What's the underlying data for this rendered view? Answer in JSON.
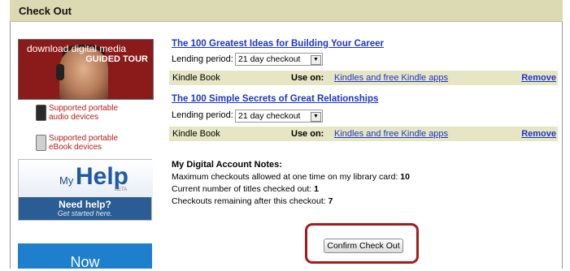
{
  "header": {
    "title": "Check Out"
  },
  "sidebar": {
    "banner": {
      "line1": "download digital media",
      "line2": "GUIDED TOUR"
    },
    "devices": [
      {
        "label_line1": "Supported portable",
        "label_line2": "audio devices"
      },
      {
        "label_line1": "Supported portable",
        "label_line2": "eBook devices"
      }
    ],
    "myhelp": {
      "my": "My",
      "help": "Help",
      "beta": "BETA",
      "need_help": "Need help?",
      "get_started": "Get started here."
    },
    "now": "Now"
  },
  "items": [
    {
      "title": "The 100 Greatest Ideas for Building Your Career",
      "lending_label": "Lending period:",
      "lending_value": "21 day checkout",
      "format": "Kindle Book",
      "use_on_label": "Use on:",
      "use_on_link": "Kindles and free Kindle apps",
      "remove": "Remove"
    },
    {
      "title": "The 100 Simple Secrets of Great Relationships",
      "lending_label": "Lending period:",
      "lending_value": "21 day checkout",
      "format": "Kindle Book",
      "use_on_label": "Use on:",
      "use_on_link": "Kindles and free Kindle apps",
      "remove": "Remove"
    }
  ],
  "notes": {
    "heading": "My Digital Account Notes:",
    "max_label": "Maximum checkouts allowed at one time on my library card:",
    "max_value": "10",
    "current_label": "Current number of titles checked out:",
    "current_value": "1",
    "remaining_label": "Checkouts remaining after this checkout:",
    "remaining_value": "7"
  },
  "confirm_button": "Confirm Check Out",
  "colors": {
    "header_bg": "#dcdab2",
    "link": "#1d36c6",
    "highlight_border": "#a31c1c",
    "book_bar": "#e7e6c4"
  }
}
